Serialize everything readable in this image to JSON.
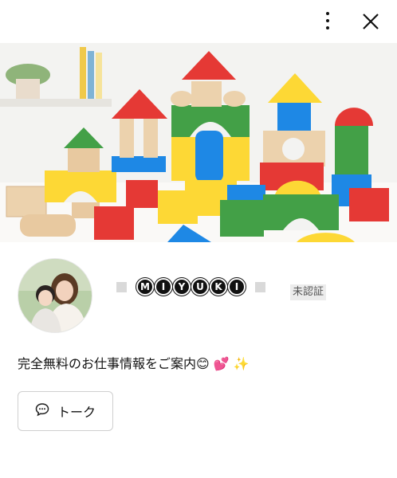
{
  "header": {
    "menu_icon": "more-vertical-icon",
    "close_icon": "close-icon"
  },
  "profile": {
    "name_letters": [
      "M",
      "I",
      "Y",
      "U",
      "K",
      "I"
    ],
    "verification_badge": "未認証",
    "status_message": "完全無料のお仕事情報をご案内",
    "status_emojis": "😊 💕 ✨"
  },
  "actions": {
    "talk_label": "トーク",
    "talk_icon": "chat-bubble-icon"
  },
  "colors": {
    "block_red": "#e53935",
    "block_blue": "#1e88e5",
    "block_yellow": "#fdd835",
    "block_green": "#43a047",
    "block_wood": "#e8c9a0"
  }
}
